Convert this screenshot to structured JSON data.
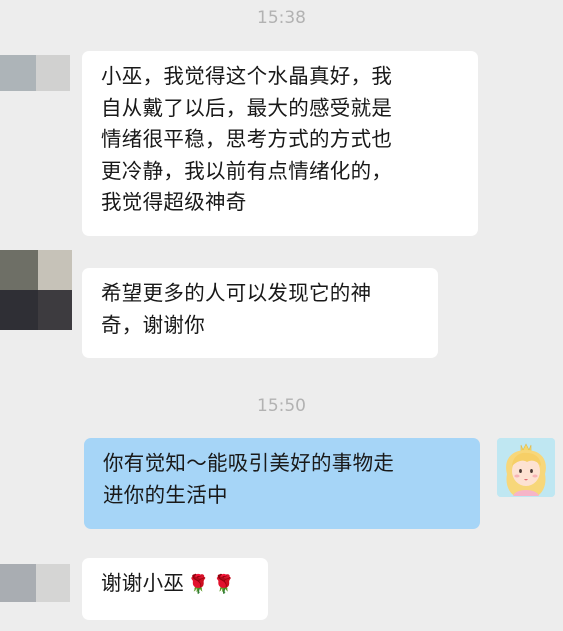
{
  "chat": {
    "time_1": "15:38",
    "time_2": "15:50",
    "messages": [
      {
        "side": "left",
        "lines": [
          "小巫，我觉得这个水晶真好，我",
          "自从戴了以后，最大的感受就是",
          "情绪很平稳，思考方式的方式也",
          "更冷静，我以前有点情绪化的，",
          "我觉得超级神奇"
        ]
      },
      {
        "side": "left",
        "lines": [
          "希望更多的人可以发现它的神",
          "奇，谢谢你"
        ]
      },
      {
        "side": "right",
        "lines": [
          "你有觉知～能吸引美好的事物走",
          "进你的生活中"
        ]
      },
      {
        "side": "left",
        "text": "谢谢小巫",
        "emoji": [
          "🌹",
          "🌹"
        ]
      }
    ]
  },
  "icons": {
    "contact_avatar": "blurred-contact-avatar-icon",
    "self_avatar": "blonde-girl-cartoon-avatar-icon",
    "rose": "rose-emoji"
  },
  "colors": {
    "background": "#ededed",
    "incoming_bubble": "#ffffff",
    "outgoing_bubble": "#a6d5f7",
    "timestamp_text": "#b2b2b2"
  }
}
